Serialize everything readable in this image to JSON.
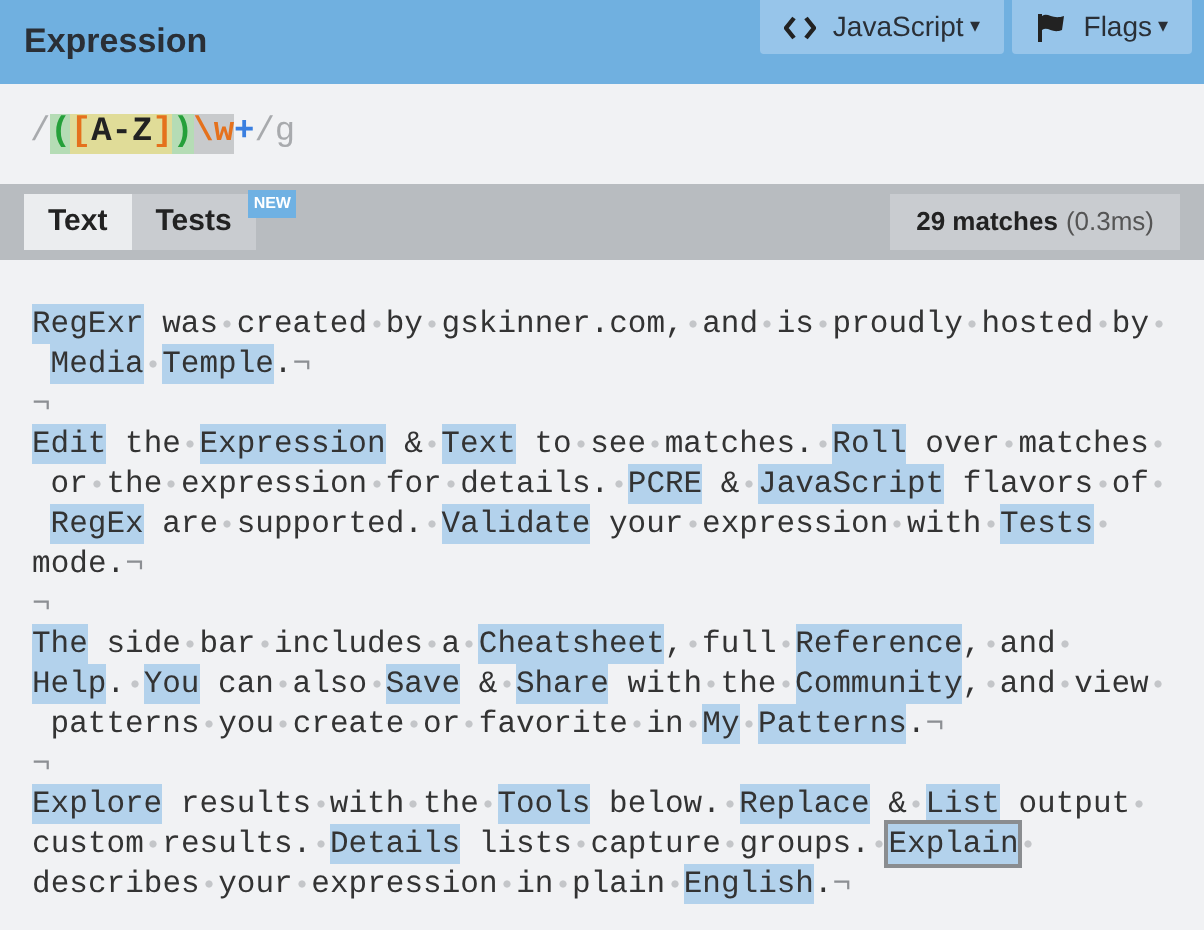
{
  "header": {
    "title": "Expression",
    "buttons": [
      {
        "kind": "code",
        "label": "JavaScript",
        "caret": "▾"
      },
      {
        "kind": "flag",
        "label": "Flags",
        "caret": "▾"
      }
    ]
  },
  "expression": [
    {
      "text": "/",
      "kind": "delimiter"
    },
    {
      "text": "(",
      "kind": "group"
    },
    {
      "text": "[",
      "kind": "set-bracket"
    },
    {
      "text": "A-Z",
      "kind": "set-range"
    },
    {
      "text": "]",
      "kind": "set-bracket"
    },
    {
      "text": ")",
      "kind": "group"
    },
    {
      "text": "\\w",
      "kind": "escape"
    },
    {
      "text": "+",
      "kind": "quantifier"
    },
    {
      "text": "/g",
      "kind": "delimiter"
    }
  ],
  "tabs": [
    {
      "label": "Text",
      "selected": true
    },
    {
      "label": "Tests",
      "selected": false,
      "badge": "NEW"
    }
  ],
  "match_count": {
    "count": "29 matches",
    "time": "(0.3ms)"
  },
  "editor_lines": [
    [
      {
        "t": "RegExr",
        "kind": "match"
      },
      {
        "t": " was created by gskinner.com, and is proudly hosted by ",
        "kind": "text"
      }
    ],
    [
      {
        "kind": "indent"
      },
      {
        "t": "Media",
        "kind": "match"
      },
      {
        "kind": "space"
      },
      {
        "t": "Temple",
        "kind": "match"
      },
      {
        "t": ".¬",
        "kind": "text"
      }
    ],
    [
      {
        "t": "¬",
        "kind": "text"
      }
    ],
    [
      {
        "t": "Edit",
        "kind": "match"
      },
      {
        "t": " the ",
        "kind": "text"
      },
      {
        "t": "Expression",
        "kind": "match"
      },
      {
        "t": " & ",
        "kind": "text"
      },
      {
        "t": "Text",
        "kind": "match"
      },
      {
        "t": " to see matches. ",
        "kind": "text"
      },
      {
        "t": "Roll",
        "kind": "match"
      },
      {
        "t": " over matches ",
        "kind": "text"
      }
    ],
    [
      {
        "t": " or the expression for details. ",
        "kind": "text"
      },
      {
        "t": "PCRE",
        "kind": "match"
      },
      {
        "t": " & ",
        "kind": "text"
      },
      {
        "t": "JavaScript",
        "kind": "match"
      },
      {
        "t": " flavors of ",
        "kind": "text"
      }
    ],
    [
      {
        "kind": "indent"
      },
      {
        "t": "RegEx",
        "kind": "match"
      },
      {
        "t": " are supported. ",
        "kind": "text"
      },
      {
        "t": "Validate",
        "kind": "match"
      },
      {
        "t": " your expression with ",
        "kind": "text"
      },
      {
        "t": "Tests",
        "kind": "match"
      },
      {
        "kind": "space"
      }
    ],
    [
      {
        "t": "mode.¬",
        "kind": "text"
      }
    ],
    [
      {
        "t": "¬",
        "kind": "text"
      }
    ],
    [
      {
        "t": "The",
        "kind": "match"
      },
      {
        "t": " side bar includes a ",
        "kind": "text"
      },
      {
        "t": "Cheatsheet",
        "kind": "match"
      },
      {
        "t": ", full ",
        "kind": "text"
      },
      {
        "t": "Reference",
        "kind": "match"
      },
      {
        "t": ", and ",
        "kind": "text"
      }
    ],
    [
      {
        "t": "Help",
        "kind": "match"
      },
      {
        "t": ". ",
        "kind": "text"
      },
      {
        "t": "You",
        "kind": "match"
      },
      {
        "t": " can also ",
        "kind": "text"
      },
      {
        "t": "Save",
        "kind": "match"
      },
      {
        "t": " & ",
        "kind": "text"
      },
      {
        "t": "Share",
        "kind": "match"
      },
      {
        "t": " with the ",
        "kind": "text"
      },
      {
        "t": "Community",
        "kind": "match"
      },
      {
        "t": ", and view ",
        "kind": "text"
      }
    ],
    [
      {
        "t": " patterns you create or favorite in ",
        "kind": "text"
      },
      {
        "t": "My",
        "kind": "match"
      },
      {
        "kind": "space"
      },
      {
        "t": "Patterns",
        "kind": "match"
      },
      {
        "t": ".¬",
        "kind": "text"
      }
    ],
    [
      {
        "t": "¬",
        "kind": "text"
      }
    ],
    [
      {
        "t": "Explore",
        "kind": "match"
      },
      {
        "t": " results with the ",
        "kind": "text"
      },
      {
        "t": "Tools",
        "kind": "match"
      },
      {
        "t": " below. ",
        "kind": "text"
      },
      {
        "t": "Replace",
        "kind": "match"
      },
      {
        "t": " & ",
        "kind": "text"
      },
      {
        "t": "List",
        "kind": "match"
      },
      {
        "t": " output ",
        "kind": "text"
      }
    ],
    [
      {
        "t": "custom results. ",
        "kind": "text"
      },
      {
        "t": "Details",
        "kind": "match"
      },
      {
        "t": " lists capture groups. ",
        "kind": "text"
      },
      {
        "t": "Explain",
        "kind": "hovered-match"
      },
      {
        "kind": "space"
      }
    ],
    [
      {
        "t": "describes your expression in plain ",
        "kind": "text"
      },
      {
        "t": "English",
        "kind": "match"
      },
      {
        "t": ".¬",
        "kind": "text"
      }
    ]
  ]
}
